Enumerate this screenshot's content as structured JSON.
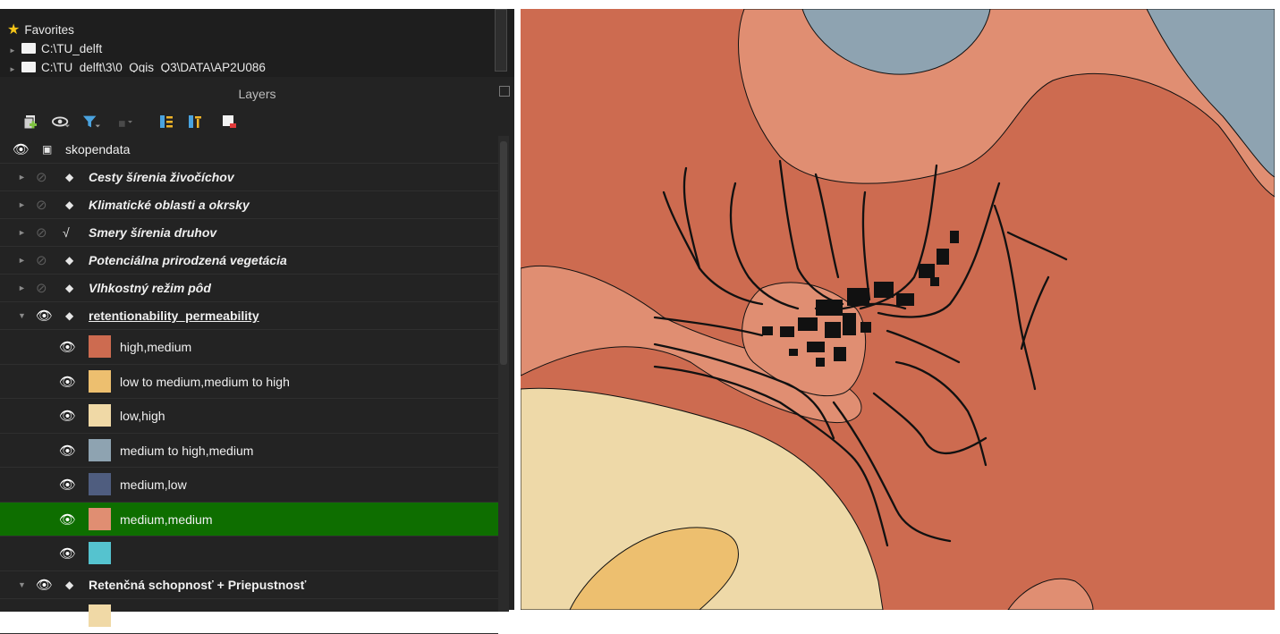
{
  "browser": {
    "favorites_label": "Favorites",
    "paths": [
      "C:\\TU_delft",
      "C:\\TU_delft\\3\\0_Qgis_Q3\\DATA\\AP2U086"
    ]
  },
  "panel": {
    "title": "Layers"
  },
  "toolbar": {
    "icons": [
      "add-group-icon",
      "manage-visibility-icon",
      "filter-legend-icon",
      "filter-by-expression-icon",
      "expand-all-icon",
      "collapse-all-icon",
      "remove-layer-icon"
    ]
  },
  "layers": {
    "root_group": "skopendata",
    "items": [
      {
        "name": "Cesty šírenia živočíchov",
        "visible": false,
        "type": "polygon"
      },
      {
        "name": "Klimatické oblasti a okrsky",
        "visible": false,
        "type": "polygon"
      },
      {
        "name": "Smery šírenia druhov",
        "visible": false,
        "type": "line"
      },
      {
        "name": "Potenciálna prirodzená vegetácia",
        "visible": false,
        "type": "polygon"
      },
      {
        "name": "Vlhkostný režim pôd",
        "visible": false,
        "type": "polygon"
      },
      {
        "name": "retentionability_permeability",
        "visible": true,
        "type": "polygon",
        "expanded": true
      },
      {
        "name": "Retenčná schopnosť + Priepustnosť",
        "visible": true,
        "type": "polygon",
        "expanded": true
      }
    ],
    "symbols": [
      {
        "label": "high,medium",
        "color": "#cd6b50"
      },
      {
        "label": "low to medium,medium to high",
        "color": "#edbf6f"
      },
      {
        "label": "low,high",
        "color": "#f0d9a6"
      },
      {
        "label": "medium to high,medium",
        "color": "#8ea3b1"
      },
      {
        "label": "medium,low",
        "color": "#4f5d7f"
      },
      {
        "label": "medium,medium",
        "color": "#e08e72",
        "selected": true
      },
      {
        "label": "",
        "color": "#55c3cf"
      }
    ]
  },
  "map": {
    "colors": {
      "high_medium": "#cd6b50",
      "medium_medium": "#e08e72",
      "medium_to_high_medium": "#8ea3b1",
      "low_high": "#eed9a8",
      "low_to_medium_medium_to_high": "#edbf6f",
      "lines": "#111111"
    }
  }
}
